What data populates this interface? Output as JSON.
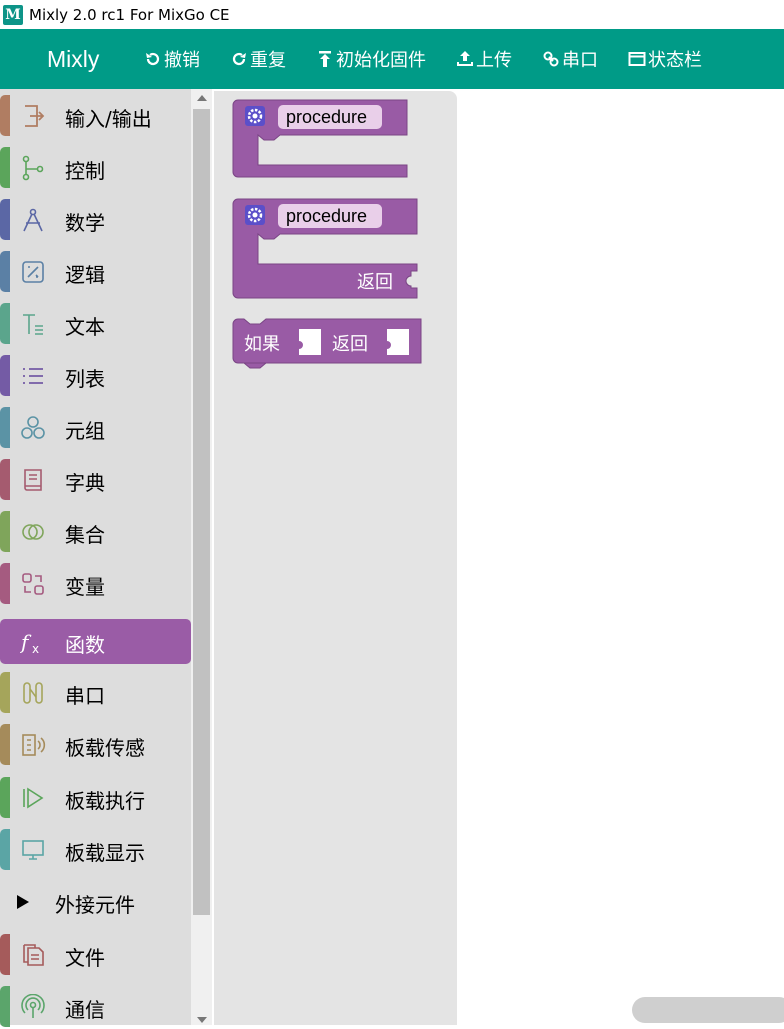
{
  "window": {
    "title": "Mixly 2.0 rc1 For MixGo CE",
    "icon": "mixly-logo-icon",
    "icon_glyph": "M"
  },
  "toolbar": {
    "brand": "Mixly",
    "undo": "撤销",
    "redo": "重复",
    "init_firmware": "初始化固件",
    "upload": "上传",
    "serial": "串口",
    "statusbar": "状态栏"
  },
  "categories": [
    {
      "label": "输入/输出",
      "icon": "input-output-icon",
      "color": "#b07d62"
    },
    {
      "label": "控制",
      "icon": "control-icon",
      "color": "#5ba55b"
    },
    {
      "label": "数学",
      "icon": "math-compass-icon",
      "color": "#5b67a5"
    },
    {
      "label": "逻辑",
      "icon": "logic-icon",
      "color": "#5b80a5"
    },
    {
      "label": "文本",
      "icon": "text-icon",
      "color": "#5ba58c"
    },
    {
      "label": "列表",
      "icon": "list-icon",
      "color": "#745ba5"
    },
    {
      "label": "元组",
      "icon": "tuple-icon",
      "color": "#5b93a5"
    },
    {
      "label": "字典",
      "icon": "dictionary-icon",
      "color": "#a55b6f"
    },
    {
      "label": "集合",
      "icon": "set-icon",
      "color": "#7fa55b"
    },
    {
      "label": "变量",
      "icon": "variable-icon",
      "color": "#a55b80"
    },
    {
      "label": "函数",
      "icon": "function-icon",
      "color": "#9a5ca6",
      "selected": true
    },
    {
      "label": "串口",
      "icon": "serial-icon",
      "color": "#a5a55b"
    },
    {
      "label": "板载传感",
      "icon": "onboard-sensor-icon",
      "color": "#a58b5b"
    },
    {
      "label": "板载执行",
      "icon": "onboard-actuator-icon",
      "color": "#5ba55b"
    },
    {
      "label": "板载显示",
      "icon": "onboard-display-icon",
      "color": "#5ba5a5"
    },
    {
      "label": "外接元件",
      "icon": "expand-triangle-icon",
      "color": "",
      "plain": true
    },
    {
      "label": "文件",
      "icon": "file-icon",
      "color": "#a55b5b"
    },
    {
      "label": "通信",
      "icon": "communication-icon",
      "color": "#5ba56b"
    }
  ],
  "blocks": {
    "proc_no_return": {
      "name": "procedure"
    },
    "proc_return": {
      "name": "procedure",
      "return_label": "返回"
    },
    "if_return": {
      "if_label": "如果",
      "return_label": "返回"
    }
  },
  "colors": {
    "toolbar": "#009b87",
    "block": "#995ba5",
    "selected": "#9a5ca6"
  }
}
